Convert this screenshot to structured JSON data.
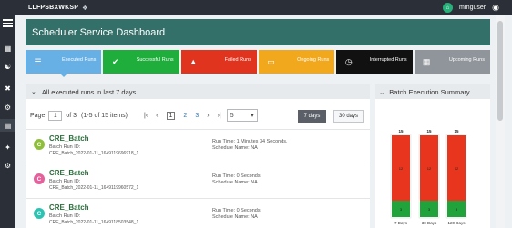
{
  "topbar": {
    "brand": "LLFPSBXWKSP",
    "user": "mmguser"
  },
  "header": {
    "title": "Scheduler Service Dashboard"
  },
  "tiles": [
    {
      "label": "Executed Runs",
      "color": "#67b0e6",
      "icon": "database-icon"
    },
    {
      "label": "Successful Runs",
      "color": "#1fae3c",
      "icon": "check-icon"
    },
    {
      "label": "Failed Runs",
      "color": "#e0341f",
      "icon": "warning-icon"
    },
    {
      "label": "Ongoing Runs",
      "color": "#f2a81d",
      "icon": "folder-icon"
    },
    {
      "label": "Interrupted Runs",
      "color": "#111111",
      "icon": "clock-icon"
    },
    {
      "label": "Upcoming Runs",
      "color": "#8f959b",
      "icon": "calendar-icon"
    }
  ],
  "runs": {
    "title": "All executed runs in last 7 days",
    "pager": {
      "page_label": "Page",
      "page": "1",
      "of_label": "of 3",
      "items_label": "(1-5 of 15 items)",
      "pages": [
        "1",
        "2",
        "3"
      ],
      "page_size": "5"
    },
    "range_buttons": [
      "7 days",
      "30 days"
    ],
    "items": [
      {
        "initial": "C",
        "avatar_color": "#8fbf3a",
        "name": "CRE_Batch",
        "run_id_label": "Batch Run ID:",
        "run_id": "CRE_Batch_2022-01-11_1649119696918_1",
        "run_time": "Run Time: 1 Minutes 34 Seconds.",
        "schedule": "Schedule Name: NA"
      },
      {
        "initial": "C",
        "avatar_color": "#e6609b",
        "name": "CRE_Batch",
        "run_id_label": "Batch Run ID:",
        "run_id": "CRE_Batch_2022-01-11_1649119960572_1",
        "run_time": "Run Time: 0 Seconds.",
        "schedule": "Schedule Name: NA"
      },
      {
        "initial": "C",
        "avatar_color": "#2dc3b2",
        "name": "CRE_Batch",
        "run_id_label": "Batch Run ID:",
        "run_id": "CRE_Batch_2022-01-11_1649118503548_1",
        "run_time": "Run Time: 0 Seconds.",
        "schedule": "Schedule Name: NA"
      }
    ]
  },
  "summary": {
    "title": "Batch Execution Summary"
  },
  "chart_data": {
    "type": "bar",
    "stacked": true,
    "categories": [
      "7 Days",
      "30 Days",
      "120 Days"
    ],
    "series": [
      {
        "values": [
          3,
          3,
          3
        ],
        "color": "#21a33b"
      },
      {
        "values": [
          12,
          12,
          12
        ],
        "color": "#e8361e"
      }
    ],
    "totals": [
      "15",
      "15",
      "15"
    ],
    "inner_labels": [
      "12",
      "12",
      "12"
    ],
    "ylim": [
      0,
      15
    ]
  }
}
